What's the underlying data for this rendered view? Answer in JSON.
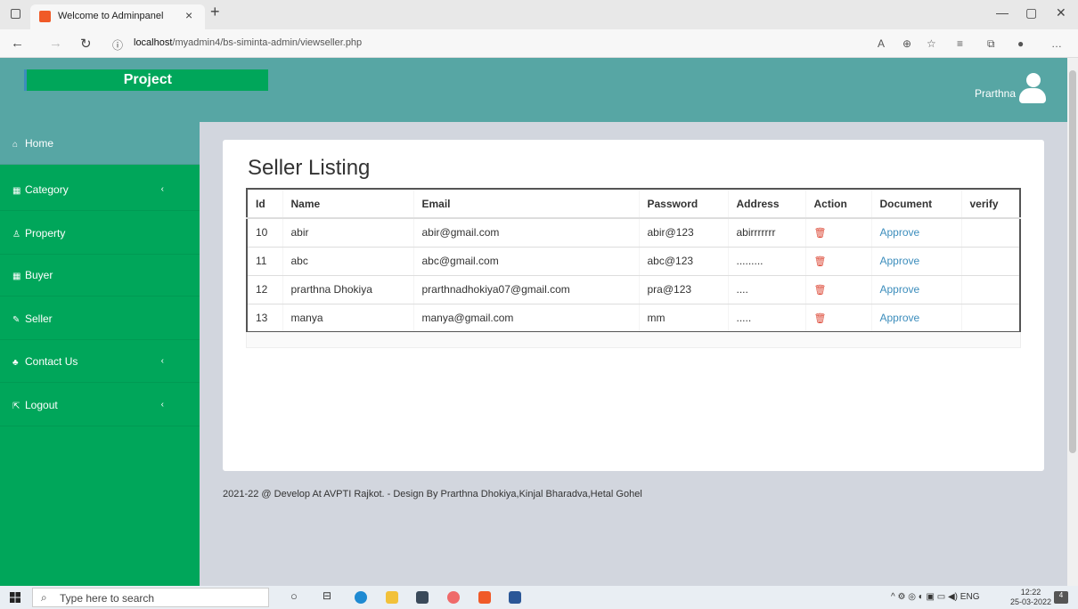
{
  "browser": {
    "tab_title": "Welcome to Adminpanel",
    "tab_close": "×",
    "new_tab": "+",
    "url_host": "localhost",
    "url_path": "/myadmin4/bs-siminta-admin/viewseller.php"
  },
  "header": {
    "logo_text": "Project",
    "username": "Prarthna"
  },
  "sidebar": {
    "items": [
      {
        "label": "Home",
        "icon": "home-icon",
        "glyph": "⌂",
        "expandable": false,
        "active": true
      },
      {
        "label": "Category",
        "icon": "chart-icon",
        "glyph": "▦",
        "expandable": true,
        "active": false
      },
      {
        "label": "Property",
        "icon": "property-icon",
        "glyph": "♙",
        "expandable": false,
        "active": false
      },
      {
        "label": "Buyer",
        "icon": "table-icon",
        "glyph": "▦",
        "expandable": false,
        "active": false
      },
      {
        "label": "Seller",
        "icon": "edit-icon",
        "glyph": "✎",
        "expandable": false,
        "active": false
      },
      {
        "label": "Contact Us",
        "icon": "sitemap-icon",
        "glyph": "♣",
        "expandable": true,
        "active": false
      },
      {
        "label": "Logout",
        "icon": "logout-icon",
        "glyph": "⇱",
        "expandable": true,
        "active": false
      }
    ]
  },
  "main": {
    "title": "Seller Listing",
    "columns": [
      "Id",
      "Name",
      "Email",
      "Password",
      "Address",
      "Action",
      "Document",
      "verify"
    ],
    "rows": [
      {
        "id": "10",
        "name": "abir",
        "email": "abir@gmail.com",
        "password": "abir@123",
        "address": "abirrrrrrr",
        "document": "Approve",
        "verify": ""
      },
      {
        "id": "11",
        "name": "abc",
        "email": "abc@gmail.com",
        "password": "abc@123",
        "address": ".........",
        "document": "Approve",
        "verify": ""
      },
      {
        "id": "12",
        "name": "prarthna Dhokiya",
        "email": "prarthnadhokiya07@gmail.com",
        "password": "pra@123",
        "address": "....",
        "document": "Approve",
        "verify": ""
      },
      {
        "id": "13",
        "name": "manya",
        "email": "manya@gmail.com",
        "password": "mm",
        "address": ".....",
        "document": "Approve",
        "verify": ""
      }
    ],
    "footer": "2021-22 @ Develop At AVPTI Rajkot. - Design By Prarthna Dhokiya,Kinjal Bharadva,Hetal Gohel"
  },
  "taskbar": {
    "search_placeholder": "Type here to search",
    "tray_lang": "ENG",
    "time": "12:22",
    "date": "25-03-2022",
    "notifications": "4"
  },
  "colors": {
    "sidebar": "#00a65a",
    "header": "#57a6a4",
    "delete": "#dd4b39",
    "link": "#3c8dbc"
  }
}
